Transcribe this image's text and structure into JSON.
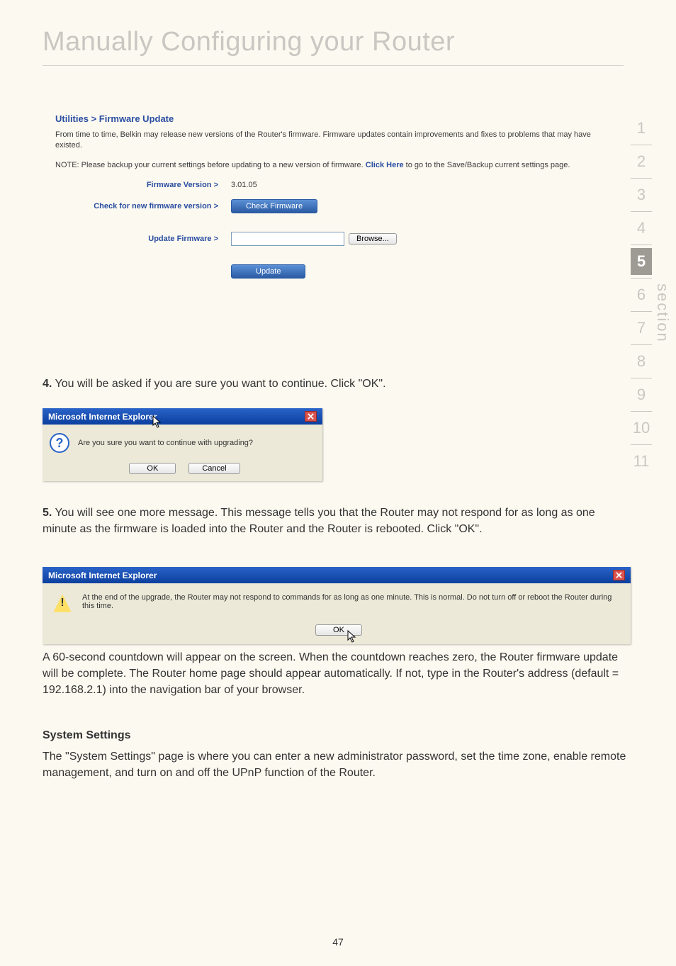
{
  "pageTitle": "Manually Configuring your Router",
  "utilities": {
    "heading": "Utilities > Firmware Update",
    "para1": "From time to time, Belkin may release new versions of the Router's firmware. Firmware updates contain improvements and fixes to problems that may have existed.",
    "para2_pre": "NOTE: Please backup your current settings before updating to a new version of firmware. ",
    "para2_link": "Click Here",
    "para2_post": " to go to the Save/Backup current settings page.",
    "row1_label": "Firmware Version >",
    "row1_value": "3.01.05",
    "row2_label": "Check for new firmware version >",
    "row2_button": "Check Firmware",
    "row3_label": "Update Firmware >",
    "row3_button": "Browse...",
    "bottom_button": "Update"
  },
  "step4_num": "4.",
  "step4_text": " You will be asked if you are sure you want to continue. Click \"OK\".",
  "dialog1": {
    "title": "Microsoft Internet Explorer",
    "msg": "Are you sure you want to continue with upgrading?",
    "ok": "OK",
    "cancel": "Cancel"
  },
  "step5_num": "5.",
  "step5_text": " You will see one more message. This message tells you that the Router may not respond for as long as one minute as the firmware is loaded into the Router and the Router is rebooted. Click \"OK\".",
  "dialog2": {
    "title": "Microsoft Internet Explorer",
    "msg": "At the end of the upgrade, the Router may not respond to commands for as long as one minute. This is normal. Do not turn off or reboot the Router during this time.",
    "ok": "OK"
  },
  "para_after": "A 60-second countdown will appear on the screen. When the countdown reaches zero, the Router firmware update will be complete. The Router home page should appear automatically. If not, type in the Router's address (default = 192.168.2.1) into the navigation bar of your browser.",
  "sys_heading": "System Settings",
  "sys_para": "The \"System Settings\" page is where you can enter a new administrator password, set the time zone, enable remote management, and turn on and off the UPnP function of the Router.",
  "side": {
    "label": "section",
    "nums": [
      "1",
      "2",
      "3",
      "4",
      "5",
      "6",
      "7",
      "8",
      "9",
      "10",
      "11"
    ],
    "active": "5"
  },
  "pageNum": "47"
}
